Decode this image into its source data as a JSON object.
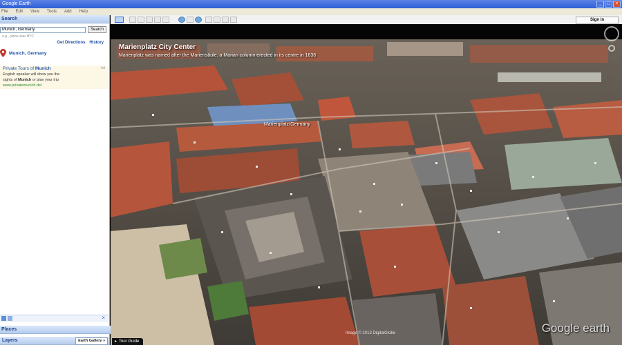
{
  "window": {
    "title": "Google Earth"
  },
  "menu": [
    "File",
    "Edit",
    "View",
    "Tools",
    "Add",
    "Help"
  ],
  "search": {
    "header": "Search",
    "value": "Munich, Germany",
    "button": "Search",
    "hint": "e.g., pizza near NYC",
    "get_directions": "Get Directions",
    "history": "History",
    "result": "Munich, Germany"
  },
  "ad": {
    "title_prefix": "Private Tours of ",
    "title_keyword": "Munich",
    "tag": "Ad",
    "line1": "English speaker will show you the",
    "line2_prefix": "sights of ",
    "line2_keyword": "Munich",
    "line2_suffix": " or plan your trip",
    "url": "www.privatemunich.de/"
  },
  "places": {
    "header": "Places"
  },
  "layers": {
    "header": "Layers",
    "gallery_button": "Earth Gallery »"
  },
  "toolbar": {
    "sign_in": "Sign in"
  },
  "view": {
    "balloon_title": "Marienplatz City Center",
    "balloon_desc": "Marienplatz was named after the Mariensäule, a Marian column erected in its centre in 1638",
    "building_label": "Marienplatz/Germany",
    "copyright": "Image © 2013 DigitalGlobe",
    "brand": "Google earth",
    "tour_guide": "Tour Guide"
  },
  "colors": {
    "accent": "#1b4fa8",
    "titlebar": "#2f5fd6",
    "roof": "#b5533a"
  }
}
